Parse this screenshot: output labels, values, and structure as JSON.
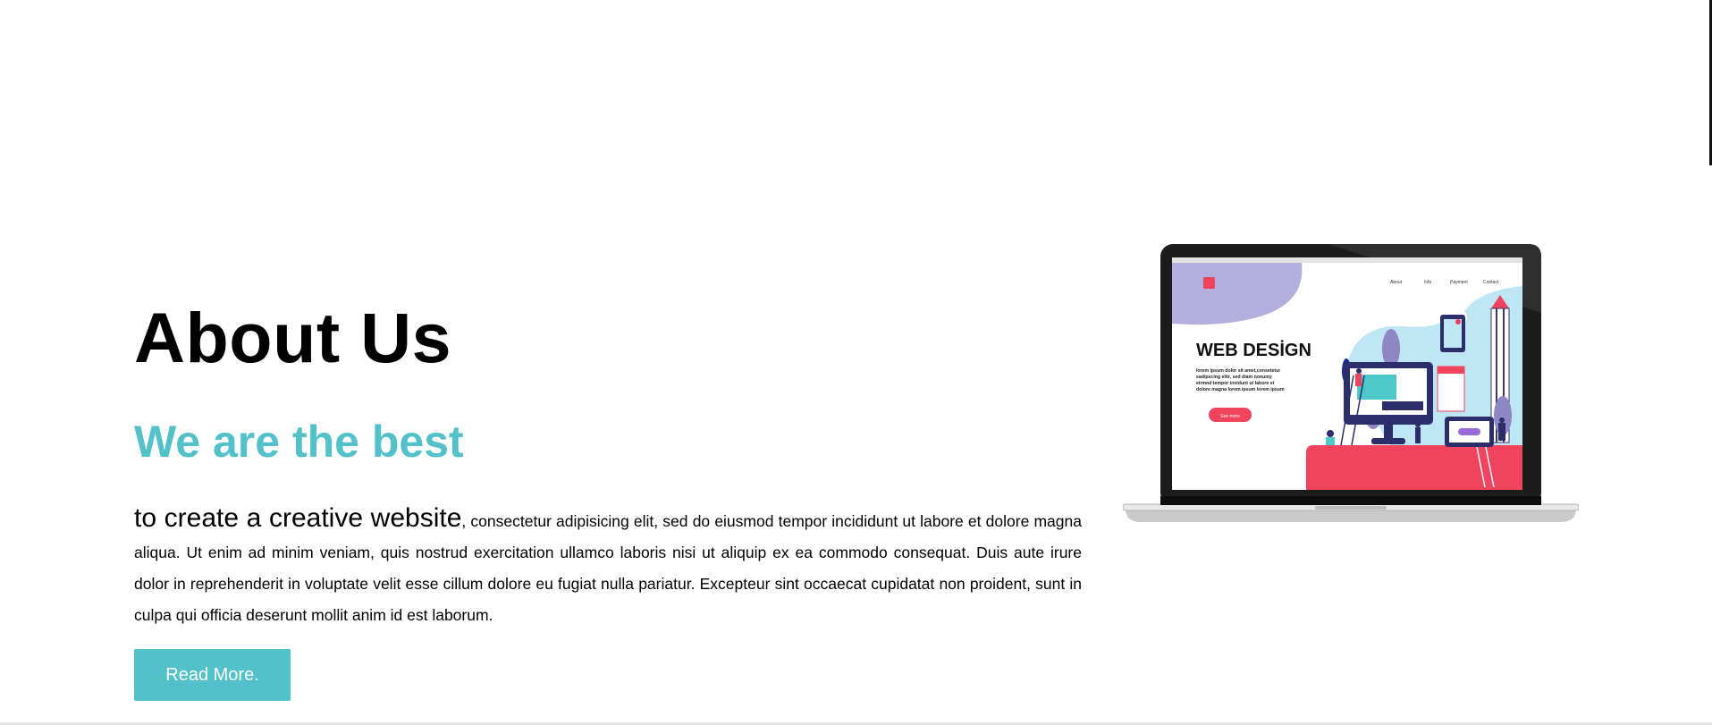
{
  "about": {
    "title": "About Us",
    "subtitle": "We are the best",
    "lead": "to create a creative website",
    "body": ", consectetur adipisicing elit, sed do eiusmod tempor incididunt ut labore et dolore magna aliqua. Ut enim ad minim veniam, quis nostrud exercitation ullamco laboris nisi ut aliquip ex ea commodo consequat. Duis aute irure dolor in reprehenderit in voluptate velit esse cillum dolore eu fugiat nulla pariatur. Excepteur sint occaecat cupidatat non proident, sunt in culpa qui officia deserunt mollit anim id est laborum.",
    "button_label": "Read More."
  },
  "laptop_screen": {
    "nav": [
      "About",
      "Info",
      "Payment",
      "Contact"
    ],
    "headline": "WEB DESİGN",
    "text_lines": [
      "lorem ipsum dolor sit amet,consetetur",
      "sadipscing elitr, sed diam nonumy",
      "eirmod tempor invidunt ut labore et",
      "dolore magna lorem ipsum lorem ipsum"
    ],
    "button_label": "See more"
  },
  "colors": {
    "accent": "#52c1c9",
    "pink": "#f0435d",
    "lavender": "#b3aedb",
    "sky": "#bfe6f4"
  }
}
